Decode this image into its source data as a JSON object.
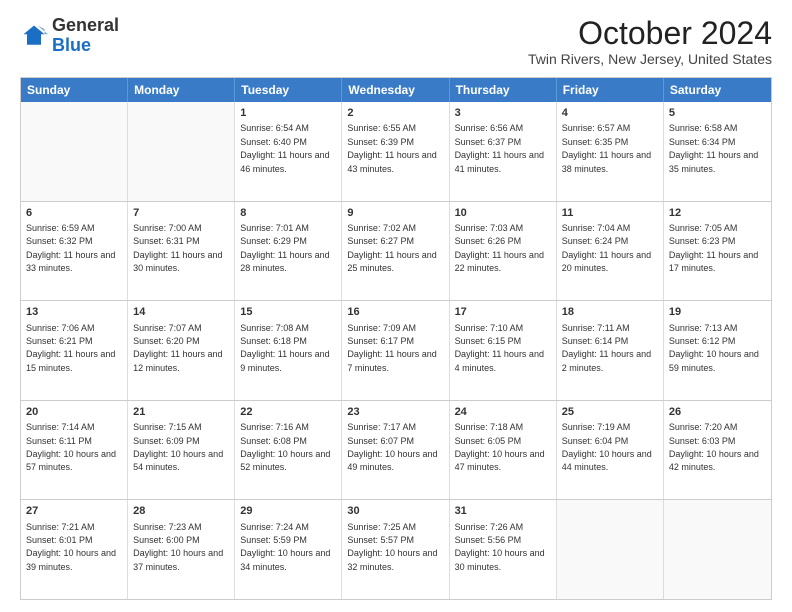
{
  "logo": {
    "general": "General",
    "blue": "Blue"
  },
  "title": "October 2024",
  "subtitle": "Twin Rivers, New Jersey, United States",
  "days": [
    "Sunday",
    "Monday",
    "Tuesday",
    "Wednesday",
    "Thursday",
    "Friday",
    "Saturday"
  ],
  "rows": [
    [
      {
        "num": "",
        "text": "",
        "empty": true
      },
      {
        "num": "",
        "text": "",
        "empty": true
      },
      {
        "num": "1",
        "text": "Sunrise: 6:54 AM\nSunset: 6:40 PM\nDaylight: 11 hours and 46 minutes."
      },
      {
        "num": "2",
        "text": "Sunrise: 6:55 AM\nSunset: 6:39 PM\nDaylight: 11 hours and 43 minutes."
      },
      {
        "num": "3",
        "text": "Sunrise: 6:56 AM\nSunset: 6:37 PM\nDaylight: 11 hours and 41 minutes."
      },
      {
        "num": "4",
        "text": "Sunrise: 6:57 AM\nSunset: 6:35 PM\nDaylight: 11 hours and 38 minutes."
      },
      {
        "num": "5",
        "text": "Sunrise: 6:58 AM\nSunset: 6:34 PM\nDaylight: 11 hours and 35 minutes."
      }
    ],
    [
      {
        "num": "6",
        "text": "Sunrise: 6:59 AM\nSunset: 6:32 PM\nDaylight: 11 hours and 33 minutes."
      },
      {
        "num": "7",
        "text": "Sunrise: 7:00 AM\nSunset: 6:31 PM\nDaylight: 11 hours and 30 minutes."
      },
      {
        "num": "8",
        "text": "Sunrise: 7:01 AM\nSunset: 6:29 PM\nDaylight: 11 hours and 28 minutes."
      },
      {
        "num": "9",
        "text": "Sunrise: 7:02 AM\nSunset: 6:27 PM\nDaylight: 11 hours and 25 minutes."
      },
      {
        "num": "10",
        "text": "Sunrise: 7:03 AM\nSunset: 6:26 PM\nDaylight: 11 hours and 22 minutes."
      },
      {
        "num": "11",
        "text": "Sunrise: 7:04 AM\nSunset: 6:24 PM\nDaylight: 11 hours and 20 minutes."
      },
      {
        "num": "12",
        "text": "Sunrise: 7:05 AM\nSunset: 6:23 PM\nDaylight: 11 hours and 17 minutes."
      }
    ],
    [
      {
        "num": "13",
        "text": "Sunrise: 7:06 AM\nSunset: 6:21 PM\nDaylight: 11 hours and 15 minutes."
      },
      {
        "num": "14",
        "text": "Sunrise: 7:07 AM\nSunset: 6:20 PM\nDaylight: 11 hours and 12 minutes."
      },
      {
        "num": "15",
        "text": "Sunrise: 7:08 AM\nSunset: 6:18 PM\nDaylight: 11 hours and 9 minutes."
      },
      {
        "num": "16",
        "text": "Sunrise: 7:09 AM\nSunset: 6:17 PM\nDaylight: 11 hours and 7 minutes."
      },
      {
        "num": "17",
        "text": "Sunrise: 7:10 AM\nSunset: 6:15 PM\nDaylight: 11 hours and 4 minutes."
      },
      {
        "num": "18",
        "text": "Sunrise: 7:11 AM\nSunset: 6:14 PM\nDaylight: 11 hours and 2 minutes."
      },
      {
        "num": "19",
        "text": "Sunrise: 7:13 AM\nSunset: 6:12 PM\nDaylight: 10 hours and 59 minutes."
      }
    ],
    [
      {
        "num": "20",
        "text": "Sunrise: 7:14 AM\nSunset: 6:11 PM\nDaylight: 10 hours and 57 minutes."
      },
      {
        "num": "21",
        "text": "Sunrise: 7:15 AM\nSunset: 6:09 PM\nDaylight: 10 hours and 54 minutes."
      },
      {
        "num": "22",
        "text": "Sunrise: 7:16 AM\nSunset: 6:08 PM\nDaylight: 10 hours and 52 minutes."
      },
      {
        "num": "23",
        "text": "Sunrise: 7:17 AM\nSunset: 6:07 PM\nDaylight: 10 hours and 49 minutes."
      },
      {
        "num": "24",
        "text": "Sunrise: 7:18 AM\nSunset: 6:05 PM\nDaylight: 10 hours and 47 minutes."
      },
      {
        "num": "25",
        "text": "Sunrise: 7:19 AM\nSunset: 6:04 PM\nDaylight: 10 hours and 44 minutes."
      },
      {
        "num": "26",
        "text": "Sunrise: 7:20 AM\nSunset: 6:03 PM\nDaylight: 10 hours and 42 minutes."
      }
    ],
    [
      {
        "num": "27",
        "text": "Sunrise: 7:21 AM\nSunset: 6:01 PM\nDaylight: 10 hours and 39 minutes."
      },
      {
        "num": "28",
        "text": "Sunrise: 7:23 AM\nSunset: 6:00 PM\nDaylight: 10 hours and 37 minutes."
      },
      {
        "num": "29",
        "text": "Sunrise: 7:24 AM\nSunset: 5:59 PM\nDaylight: 10 hours and 34 minutes."
      },
      {
        "num": "30",
        "text": "Sunrise: 7:25 AM\nSunset: 5:57 PM\nDaylight: 10 hours and 32 minutes."
      },
      {
        "num": "31",
        "text": "Sunrise: 7:26 AM\nSunset: 5:56 PM\nDaylight: 10 hours and 30 minutes."
      },
      {
        "num": "",
        "text": "",
        "empty": true
      },
      {
        "num": "",
        "text": "",
        "empty": true
      }
    ]
  ]
}
